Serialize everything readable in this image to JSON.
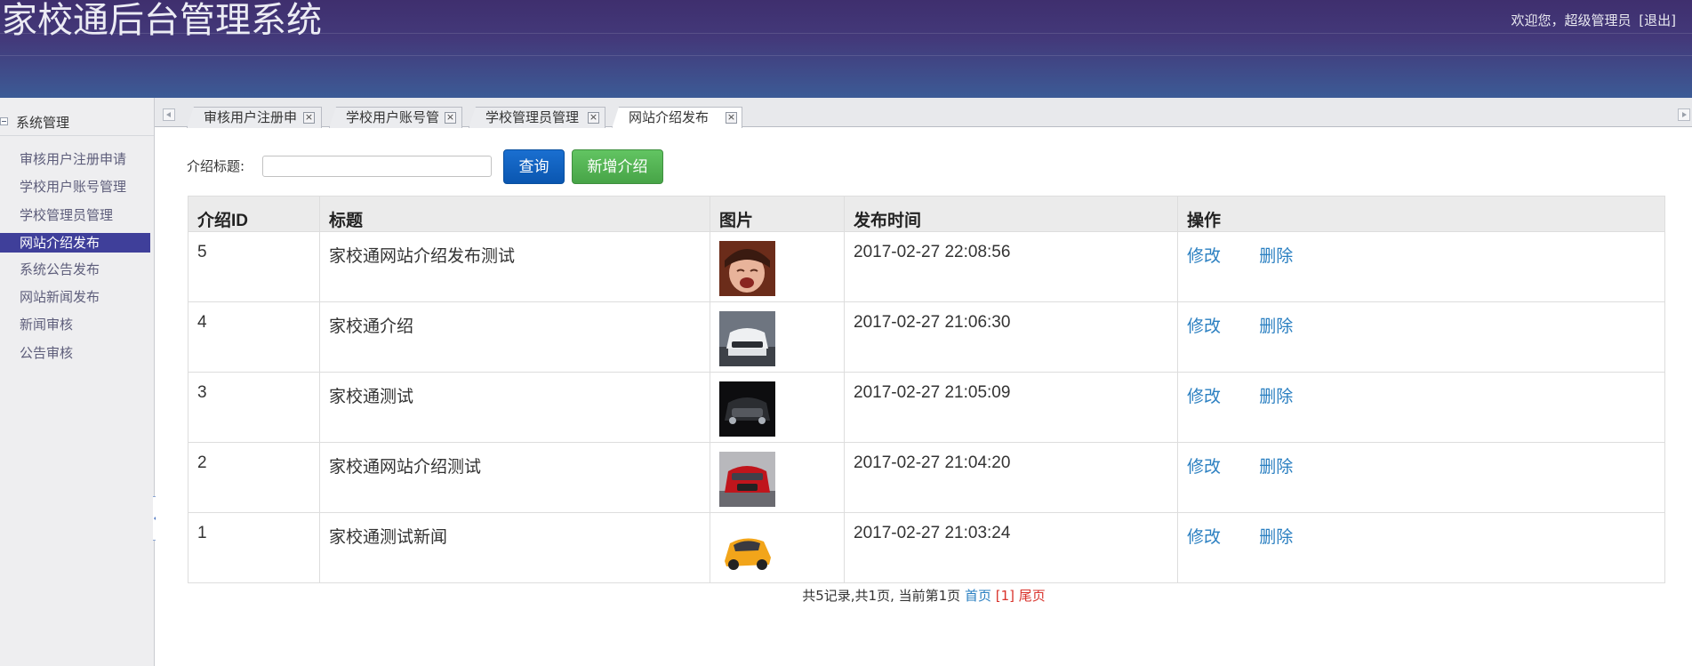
{
  "header": {
    "title": "家校通后台管理系统",
    "welcome_text": "欢迎您，超级管理员",
    "logout_label": "[退出]"
  },
  "sidebar": {
    "group_title": "系统管理",
    "items": [
      {
        "label": "审核用户注册申请"
      },
      {
        "label": "学校用户账号管理"
      },
      {
        "label": "学校管理员管理"
      },
      {
        "label": "网站介绍发布",
        "active": true
      },
      {
        "label": "系统公告发布"
      },
      {
        "label": "网站新闻发布"
      },
      {
        "label": "新闻审核"
      },
      {
        "label": "公告审核"
      }
    ]
  },
  "tabs": [
    {
      "label": "审核用户注册申"
    },
    {
      "label": "学校用户账号管"
    },
    {
      "label": "学校管理员管理"
    },
    {
      "label": "网站介绍发布",
      "active": true
    }
  ],
  "search": {
    "label": "介绍标题:",
    "value": "",
    "query_button": "查询",
    "add_button": "新增介绍"
  },
  "table": {
    "headers": [
      "介绍ID",
      "标题",
      "图片",
      "发布时间",
      "操作"
    ],
    "rows": [
      {
        "id": "5",
        "title": "家校通网站介绍发布测试",
        "image": "crying-child-photo",
        "time": "2017-02-27 22:08:56"
      },
      {
        "id": "4",
        "title": "家校通介绍",
        "image": "white-car-photo",
        "time": "2017-02-27 21:06:30"
      },
      {
        "id": "3",
        "title": "家校通测试",
        "image": "black-car-photo",
        "time": "2017-02-27 21:05:09"
      },
      {
        "id": "2",
        "title": "家校通网站介绍测试",
        "image": "red-car-photo",
        "time": "2017-02-27 21:04:20"
      },
      {
        "id": "1",
        "title": "家校通测试新闻",
        "image": "yellow-car-photo",
        "time": "2017-02-27 21:03:24"
      }
    ],
    "edit_label": "修改",
    "delete_label": "删除"
  },
  "pager": {
    "summary": "共5记录,共1页, 当前第1页",
    "first": "首页",
    "current": "[1]",
    "last": "尾页"
  },
  "colors": {
    "header_top": "#3f2f6e",
    "header_bottom": "#3c5b96",
    "sidebar_active": "#3f3f9a",
    "link": "#2a7fc1",
    "query_button": "#0a56b0",
    "add_button": "#47a447"
  }
}
